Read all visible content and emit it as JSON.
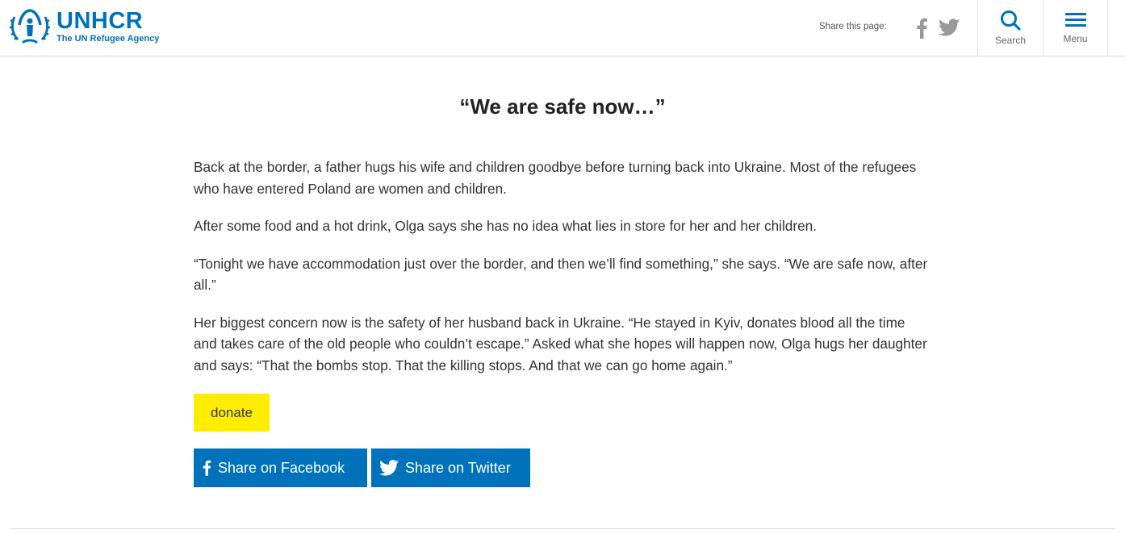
{
  "header": {
    "logo_name": "UNHCR",
    "logo_tagline": "The UN Refugee Agency",
    "share_label": "Share this page:",
    "search_label": "Search",
    "menu_label": "Menu"
  },
  "article": {
    "headline": "“We are safe now…”",
    "paragraphs": [
      "Back at the border, a father hugs his wife and children goodbye before turning back into Ukraine. Most of the refugees who have entered Poland are women and children.",
      "After some food and a hot drink, Olga says she has no idea what lies in store for her and her children.",
      "“Tonight we have accommodation just over the border, and then we’ll find something,” she says. “We are safe now, after all.”",
      "Her biggest concern now is the safety of her husband back in Ukraine. “He stayed in Kyiv, donates blood all the time and takes care of the old people who couldn’t escape.” Asked what she hopes will happen now, Olga hugs her daughter and says: “That the bombs stop. That the killing stops. And that we can go home again.”"
    ]
  },
  "actions": {
    "donate_label": "donate",
    "share_facebook_label": "Share on Facebook",
    "share_twitter_label": "Share on Twitter"
  },
  "icons": {
    "logo": "unhcr-emblem-icon",
    "facebook": "facebook-icon",
    "twitter": "twitter-icon",
    "search": "search-icon",
    "menu": "hamburger-menu-icon"
  },
  "colors": {
    "brand_blue": "#0072bc",
    "donate_yellow": "#ffed00",
    "header_icon_gray": "#999999"
  }
}
